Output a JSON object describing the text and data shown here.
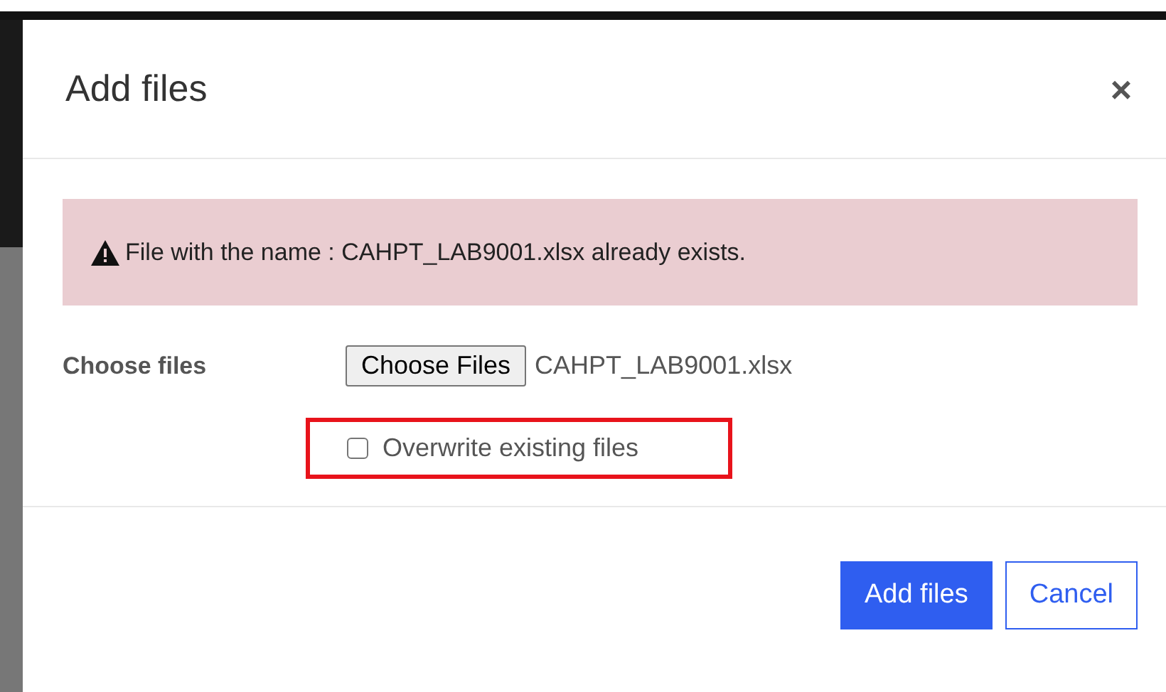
{
  "dialog": {
    "title": "Add files",
    "close": "×"
  },
  "alert": {
    "message": "File with the name : CAHPT_LAB9001.xlsx already exists."
  },
  "file_field": {
    "label": "Choose files",
    "button": "Choose Files",
    "file_name": "CAHPT_LAB9001.xlsx"
  },
  "overwrite": {
    "label": "Overwrite existing files",
    "checked": false,
    "highlighted": true
  },
  "buttons": [
    {
      "label": "Add files",
      "kind": "primary"
    },
    {
      "label": "Cancel",
      "kind": "secondary"
    }
  ]
}
